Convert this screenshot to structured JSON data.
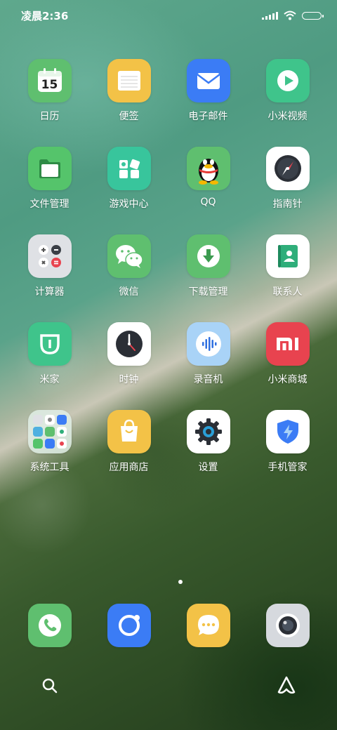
{
  "status_bar": {
    "time": "凌晨2:36"
  },
  "apps": [
    {
      "name": "日历",
      "icon": "calendar-icon",
      "color": "#5fbf6f",
      "date": "15"
    },
    {
      "name": "便签",
      "icon": "notes-icon",
      "color": "#f3c247"
    },
    {
      "name": "电子邮件",
      "icon": "email-icon",
      "color": "#3b7cf5"
    },
    {
      "name": "小米视频",
      "icon": "video-icon",
      "color": "#3fc48b"
    },
    {
      "name": "文件管理",
      "icon": "folder-icon",
      "color": "#55c46b"
    },
    {
      "name": "游戏中心",
      "icon": "game-center-icon",
      "color": "#38c59c"
    },
    {
      "name": "QQ",
      "icon": "qq-penguin-icon",
      "color": "#5fbf6f"
    },
    {
      "name": "指南针",
      "icon": "compass-icon",
      "color": "#ffffff"
    },
    {
      "name": "计算器",
      "icon": "calculator-icon",
      "color": "#dfe1e5"
    },
    {
      "name": "微信",
      "icon": "wechat-icon",
      "color": "#5fbf6f"
    },
    {
      "name": "下载管理",
      "icon": "download-icon",
      "color": "#5fbf6f"
    },
    {
      "name": "联系人",
      "icon": "contacts-icon",
      "color": "#ffffff"
    },
    {
      "name": "米家",
      "icon": "mijia-icon",
      "color": "#3fc48b"
    },
    {
      "name": "时钟",
      "icon": "clock-icon",
      "color": "#ffffff"
    },
    {
      "name": "录音机",
      "icon": "recorder-icon",
      "color": "#a9d3f7"
    },
    {
      "name": "小米商城",
      "icon": "mi-store-icon",
      "color": "#e8434f"
    },
    {
      "name": "系统工具",
      "icon": "folder-system-tools-icon",
      "color": "#d7e6dc"
    },
    {
      "name": "应用商店",
      "icon": "app-store-icon",
      "color": "#f3c247"
    },
    {
      "name": "设置",
      "icon": "settings-gear-icon",
      "color": "#ffffff"
    },
    {
      "name": "手机管家",
      "icon": "security-shield-icon",
      "color": "#ffffff"
    }
  ],
  "dock": [
    {
      "icon": "phone-icon",
      "color": "#5fbf6f"
    },
    {
      "icon": "browser-icon",
      "color": "#3b7cf5"
    },
    {
      "icon": "messages-icon",
      "color": "#f3c247"
    },
    {
      "icon": "camera-icon",
      "color": "#d6d9de"
    }
  ],
  "bottom_bar": {
    "left_icon": "search-icon",
    "right_icon": "assistant-icon"
  }
}
